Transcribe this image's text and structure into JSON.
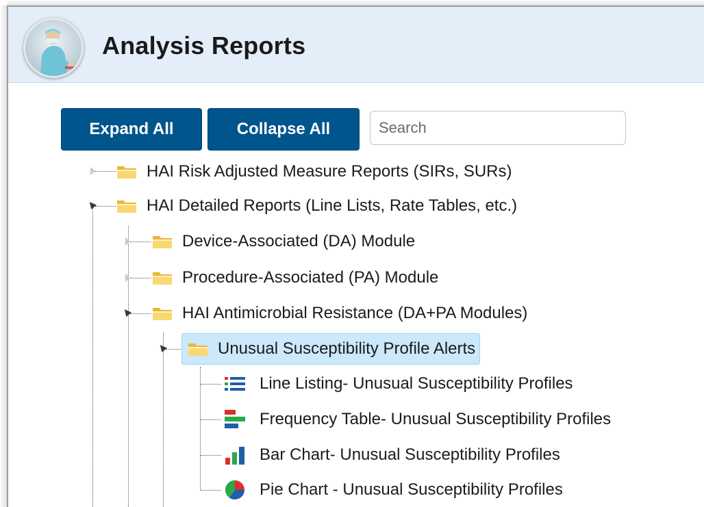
{
  "header": {
    "title": "Analysis Reports",
    "header_bg": "#e3eef9"
  },
  "toolbar": {
    "expand_all_label": "Expand All",
    "collapse_all_label": "Collapse All",
    "search_placeholder": "Search",
    "button_color": "#00558c"
  },
  "tree": {
    "items": [
      {
        "label": "HAI Risk Adjusted Measure Reports (SIRs, SURs)",
        "type": "folder",
        "expanded": false
      },
      {
        "label": "HAI Detailed Reports (Line Lists, Rate Tables, etc.)",
        "type": "folder",
        "expanded": true
      },
      {
        "label": "Device-Associated (DA) Module",
        "type": "folder",
        "expanded": false
      },
      {
        "label": "Procedure-Associated (PA) Module",
        "type": "folder",
        "expanded": false
      },
      {
        "label": "HAI Antimicrobial Resistance (DA+PA Modules)",
        "type": "folder",
        "expanded": true
      },
      {
        "label": "Unusual Susceptibility Profile Alerts",
        "type": "folder",
        "expanded": true,
        "selected": true
      },
      {
        "label": "Line Listing- Unusual Susceptibility Profiles",
        "type": "report",
        "icon": "line-listing-icon"
      },
      {
        "label": "Frequency Table- Unusual Susceptibility Profiles",
        "type": "report",
        "icon": "frequency-table-icon"
      },
      {
        "label": "Bar Chart- Unusual Susceptibility Profiles",
        "type": "report",
        "icon": "bar-chart-icon"
      },
      {
        "label": "Pie Chart - Unusual Susceptibility Profiles",
        "type": "report",
        "icon": "pie-chart-icon"
      }
    ],
    "selected_color": "#cce8fb"
  }
}
